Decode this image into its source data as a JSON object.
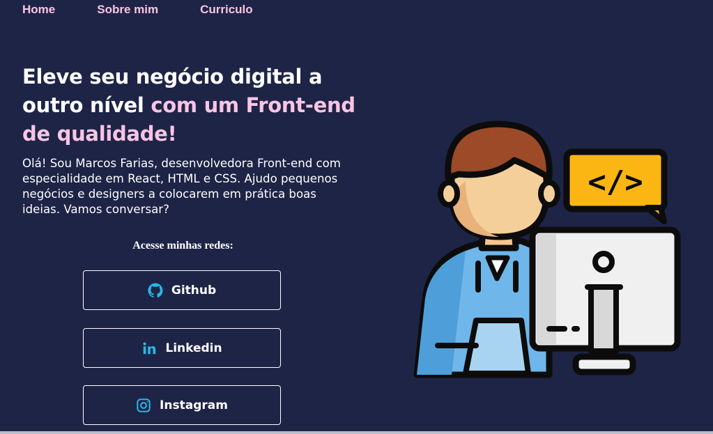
{
  "nav": {
    "home": "Home",
    "about": "Sobre mim",
    "resume": "Curriculo"
  },
  "hero": {
    "headline_part1": "Eleve seu negócio digital a outro nível ",
    "headline_highlight": "com um Front-end de qualidade!",
    "intro": "Olá! Sou Marcos Farias, desenvolvedora Front-end com especialidade em React, HTML e CSS. Ajudo pequenos negócios e designers a colocarem em prática boas ideias. Vamos conversar?"
  },
  "social": {
    "label": "Acesse minhas redes:",
    "buttons": [
      {
        "label": "Github",
        "icon": "github-icon"
      },
      {
        "label": "Linkedin",
        "icon": "linkedin-icon"
      },
      {
        "label": "Instagram",
        "icon": "instagram-icon"
      }
    ]
  },
  "illustration": {
    "icon": "developer-at-computer-illustration",
    "code_symbol": "</>"
  },
  "colors": {
    "background": "#1e2446",
    "accent_pink": "#f9c5e4",
    "icon_blue": "#29b6e8",
    "code_bubble": "#fcb614"
  }
}
